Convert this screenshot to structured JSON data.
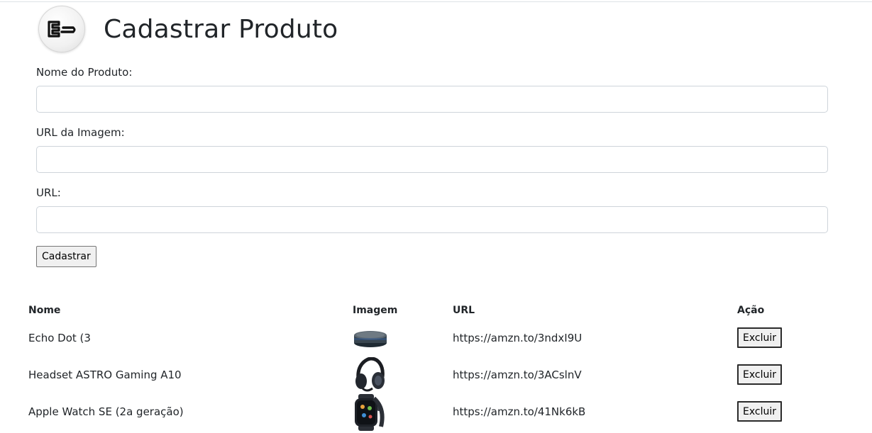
{
  "header": {
    "title": "Cadastrar Produto",
    "logo_icon": "logo-icon"
  },
  "form": {
    "name_label": "Nome do Produto:",
    "name_value": "",
    "image_label": "URL da Imagem:",
    "image_value": "",
    "url_label": "URL:",
    "url_value": "",
    "submit_label": "Cadastrar"
  },
  "table": {
    "headers": {
      "name": "Nome",
      "image": "Imagem",
      "url": "URL",
      "action": "Ação"
    },
    "rows": [
      {
        "name": "Echo Dot (3",
        "image": "echo-dot-image",
        "url": "https://amzn.to/3ndxI9U",
        "action": "Excluir"
      },
      {
        "name": "Headset ASTRO Gaming A10",
        "image": "headset-image",
        "url": "https://amzn.to/3ACslnV",
        "action": "Excluir"
      },
      {
        "name": "Apple Watch SE (2a geração)",
        "image": "apple-watch-image",
        "url": "https://amzn.to/41Nk6kB",
        "action": "Excluir"
      }
    ]
  }
}
